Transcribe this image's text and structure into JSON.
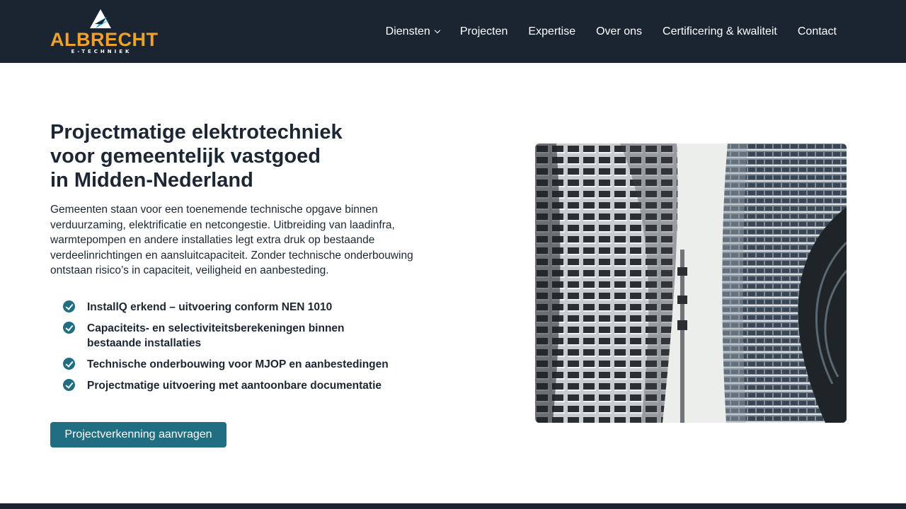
{
  "brand": {
    "name": "ALBRECHT",
    "tagline": "E-TECHNIEK",
    "accent": "#f0a12c",
    "navy": "#1b2532",
    "teal": "#1f6e82"
  },
  "nav": {
    "items": [
      {
        "label": "Diensten",
        "has_dropdown": true
      },
      {
        "label": "Projecten"
      },
      {
        "label": "Expertise"
      },
      {
        "label": "Over ons"
      },
      {
        "label": "Certificering & kwaliteit"
      },
      {
        "label": "Contact"
      }
    ]
  },
  "hero": {
    "title_lines": [
      "Projectmatige elektrotechniek",
      "voor gemeentelijk vastgoed",
      "in Midden-Nederland"
    ],
    "intro": "Gemeenten staan voor een toenemende technische opgave binnen verduurzaming, elektrificatie en netcongestie. Uitbreiding van laadinfra, warmtepompen en andere installaties legt extra druk op bestaande verdeelinrichtingen en aansluitcapaciteit. Zonder technische onderbouwing ontstaan risico’s in capaciteit, veiligheid en aanbesteding.",
    "checklist": [
      "InstallQ erkend – uitvoering conform NEN 1010",
      "Capaciteits- en selectiviteitsberekeningen binnen bestaande installaties",
      "Technische onderbouwing voor MJOP en aanbestedingen",
      "Projectmatige uitvoering met aantoonbare documentatie"
    ],
    "cta_label": "Projectverkenning aanvragen",
    "image_icon": "buildings-photo"
  }
}
